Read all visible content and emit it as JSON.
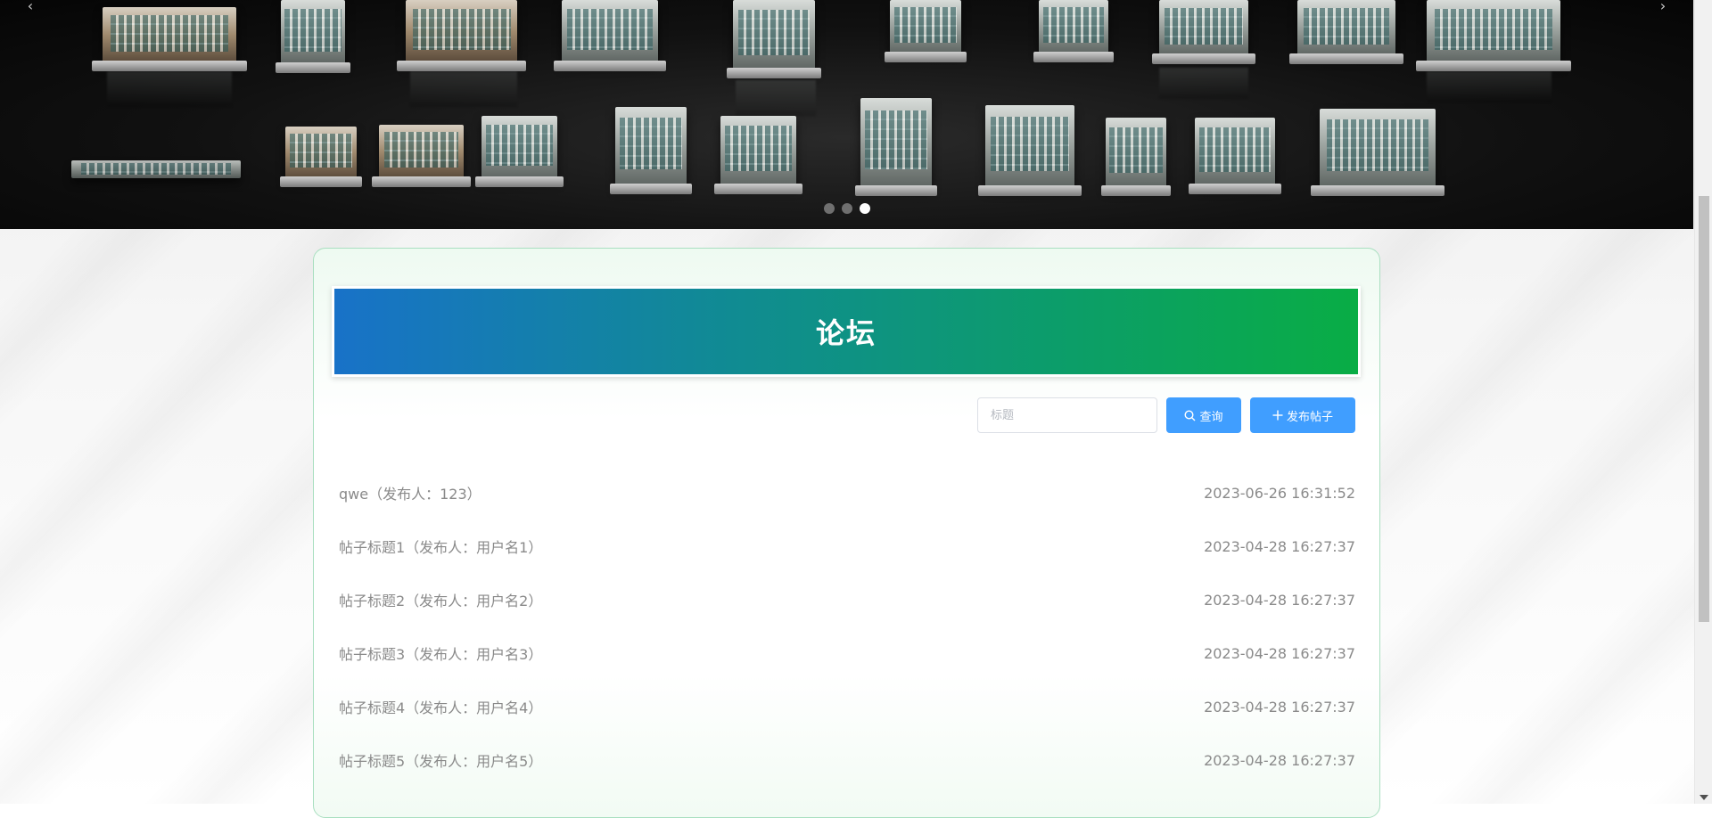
{
  "hero": {
    "prev_icon": "chevron-left-icon",
    "next_icon": "chevron-right-icon",
    "prev_glyph": "‹",
    "next_glyph": "›",
    "slide_count": 3,
    "active_slide": 3
  },
  "forum": {
    "title": "论坛",
    "search": {
      "placeholder": "标题",
      "value": ""
    },
    "search_button": {
      "label": "查询",
      "icon": "search-icon"
    },
    "add_button": {
      "label": "发布帖子",
      "icon": "plus-icon"
    },
    "posts": [
      {
        "title": "qwe（发布人：123）",
        "time": "2023-06-26 16:31:52"
      },
      {
        "title": "帖子标题1（发布人：用户名1）",
        "time": "2023-04-28 16:27:37"
      },
      {
        "title": "帖子标题2（发布人：用户名2）",
        "time": "2023-04-28 16:27:37"
      },
      {
        "title": "帖子标题3（发布人：用户名3）",
        "time": "2023-04-28 16:27:37"
      },
      {
        "title": "帖子标题4（发布人：用户名4）",
        "time": "2023-04-28 16:27:37"
      },
      {
        "title": "帖子标题5（发布人：用户名5）",
        "time": "2023-04-28 16:27:37"
      }
    ]
  },
  "colors": {
    "accent": "#409eff",
    "banner_start": "#1872c8",
    "banner_end": "#09ad45",
    "card_border": "#a9dfc0",
    "post_text": "#8a8a8a"
  }
}
